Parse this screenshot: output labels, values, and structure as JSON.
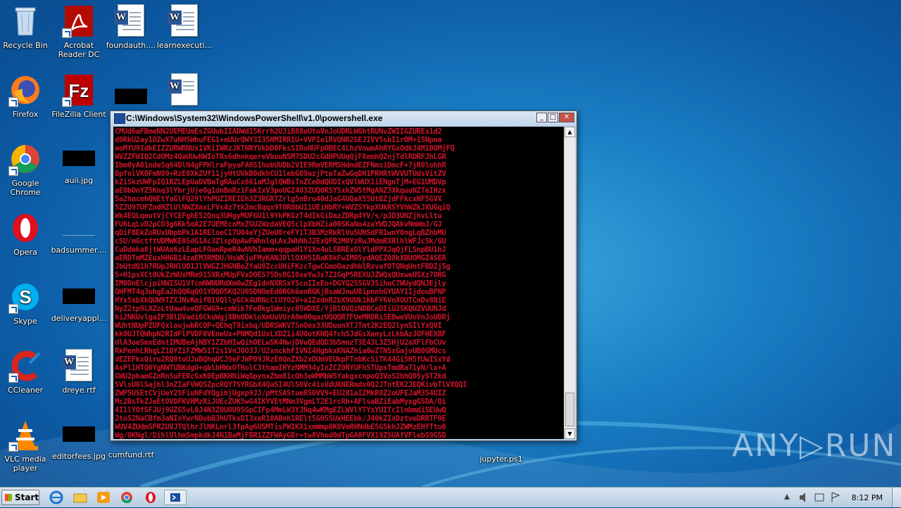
{
  "desktop": {
    "icons": [
      {
        "label": "Recycle Bin"
      },
      {
        "label": "Acrobat Reader DC"
      },
      {
        "label": "foundauth...."
      },
      {
        "label": "learnexecuti..."
      },
      {
        "label": "Firefox"
      },
      {
        "label": "FileZilla Client"
      },
      {
        "label": "Google Chrome"
      },
      {
        "label": "auii.jpg"
      },
      {
        "label": "Opera"
      },
      {
        "label": "badsummer...."
      },
      {
        "label": "Skype"
      },
      {
        "label": "deliveryappl..."
      },
      {
        "label": "CCleaner"
      },
      {
        "label": "dreye.rtf"
      },
      {
        "label": "VLC media player"
      },
      {
        "label": "editorfees.jpg"
      },
      {
        "label": "cumfund.rtf"
      },
      {
        "label": "jupyter.ps1"
      }
    ]
  },
  "window": {
    "title": "C:\\Windows\\System32\\WindowsPowerShell\\v1.0\\powershell.exe",
    "minimize": "_",
    "maximize": "□",
    "close": "✕",
    "scroll_up": "▲",
    "scroll_down": "▼",
    "text_color": "#d0132b",
    "console_lines": [
      "CMUd6aFBmeNN2UEMEUmEsZGUubIIADWd15Krrh2U3iB88eUtoVnJoUDRLWGhtRUNvZWIIGZUREx1d2",
      "d0RkU2ay1OZwX7uNHSWhuFEG1+eUUrQWY3I35HMIRR1U+VVPIe1RVQNR2SEJIVV5sbI1rOM+15Npna",
      "aoMfU9IdkEIZZURWRNUx1VKiIWRzJKTNRYVkbD0FksSIRoNUFpOBEC4LhzVowmAhRYGxOdkJ4M1BOMjFQ",
      "WVZZFWIQ2CdOMz4QaUUwNWIoTRs6dhnkqereVbuuNSM7SDU2cGdHPUUqQjFXemhQZnjTdlRDRFJhLGR",
      "Ibm0yA01ndeSq64DlN4gFPHlraFpyaFA0SIhobUUDb2VIE9RmVERMSHdndEZFNmsiDmcF+7jR0lohhR",
      "BpfnlVK0FmN09+RzE0XkZUf11jyHtUVkB0dkhCU1lebG09azjPteTaZwGqDH1PRHRtWVVUTUdsVitZV",
      "kZiSkzUWFpIQ1RZLEpUaDVBaTgRAuCx661aMJglQWBsTnZCeDdQUDIxQVlWUX1iENgnTjM+EG1UMDVp",
      "aE0bOnYZ5Knq3lYbrjUje0g1dnBnRz1FakIxV3poUGZ403ZUQ0RSYSxkZW5tMgANZ3XkquuNZTeIHzx",
      "5a2hacmhQNEtYaGlFQ29lYhPUZIREIEh3Z3RGRTZrlg5nBru40dJaG4UQaX55UtBZjdFFkcxNF5GVX",
      "5Z2U97UFZndHZlUlNWZXmxLFVs4z7tk2mcBqqx9T0R0bU11UEiHbRY+WVZSYkpXUkRSYVhWZkJXUGqiQ",
      "Wk4EQLqeutVjCYCEFghE52Qnq3UHgyMUFGU1l9YhPKGzT4dIkGiDazZDRp4YV/s/pJD3UNZjhvLltu",
      "FU6LqLvD2pCO3g6Kk5mA2E7UEMEcnMxZGU2WzdaVEQ5clpXbHZia00SKaNo4zaYWDJQAkvNmWmJ/GJ",
      "qDiF8EkZoRUxUbpbPk1A1RElneC17U04eYjZUeU8reFY1T3B3MzRkRlVuSUNSdFR1wnY0ngLqBZhbMU",
      "cSU/mGctftUDMWKE0SdG1Ac3ZlspOpAwFWhnlqLAxJWhNhJ2ExQFRJM0YzRwJMdmRXRlhlWFJcSk/GU",
      "CuDdeka8jtWUAx6zLEapLFOanRpeR4wNVhIamm+qqpaH1Y1Xn4uLSBRExOlYldPPXJqQjFLSnpBU1hJ",
      "aERDTmMZEuxHH6B14zaEM3RMDU/HsWKjuFMyKANJDllOXH51RaK8kFwIM05ydAQEZ08kXBUOMGZ4SER",
      "JbUtdQ1h7RUpJRHlUO1JlVWGZJHGNBoZfaU8ZccUHiFKzcTgwCGmoOazdhblRxvafOTQNqUntFBDZj5g",
      "5+H1psXCt0UkZzWUxMRm91SXRxMUpFVxDOES75Ds8G10xeYwJx7Z1GqP5REXUJZWQxQUxweUSXz70RG",
      "IM0OnElcjpiNWISU1VfcmNWNURdXm0wZEg1dnNXRSxYScoIIxEo+DGYQ25SGV3SihuC7WUydQNJEjly",
      "QHFMT4q3uhgEa2hQQRqQO1YDQD5KQ2U0SDNOeEd0RGh6enRGKjBsaWJnwU8ipnnhGYUAY1IjdouBFNP",
      "HYx5xbXkQUW9TZXJNvKmifB1VQllyGCk4URNcClUYO2V+a1ZxdnR2bX9UUk1KbFY6VnXOUTCnDv8NiE",
      "NyZ2tp9LAZoLtUaw4veQFGWG9+cmWik7FeBkg1Wmiyc05WDXE/YjBlOVQzNDBCeDIiU25KQUZVUUNJd",
      "hi2NKUvlgaIP3BlDVadi0CkuWgjXBhODkloXmUuVUrA0m00qazUQQQR7FUeMRDRiSEBweVUoVnJoUDRj",
      "WUhtNUpPZUFQxloujwbRCQP+QEhqT9ixbq/UDRSWKVTSnOex33UDuunXTJTmt2K2EQ2lynSIlYxQVI",
      "kk0UJTQWhpN2RIdFlPVDF0VEneUx+PNMQd1UxLXDZ1i4U0otKNQ4fchSJdGsXanyLzLkbAzJOFHEXBF",
      "dlA3oeSmxEdntIMUBeAjNBY1ZZbHIwQihOELwSK4NwjDVuQEdQD3bSmnzT3E43L3Z5HjU2aXFlFbCUv",
      "RkPenhLRhgLZ1QYZiFZMWS1T2s1VnJ0O3J/U2xnckhFIVNI4HgbkxKNAZhia0wZTNSxGajvUB0GMUcs",
      "dEZEFkxQiru2RQ9toUJuBQhqUCJ9eFJWP09JRzE0QnZXb2xDUmVEUkpFTnbKcSiTK44Gi5H5fUwISxYd",
      "AsPl1HTQ0YgNWTUBKdgO+qblbHWxOTHolC3thamIHYzNMM34yInZCZ0RYUFhSTUpsTmdRa71yN/lx+A",
      "GWU2pkamGZnRnSuFERcGxK0EpBKHNiWqGpynxZbm81cQh3eWMMbW5YakgxcnpoQ3VoS2hhQ05yST2kd",
      "SVlsU0lSajhl3nZIaFVWQSZpcRQY7SYRGbX4QaSI4UlS0Vc4isVdUANERmdv0Q2JTntEK2JEQKivbTlVXQQI",
      "ZWP5USEtCVjUeY25FiuNFdYQgihjUgxp9JJ/pMtSAStueR50VV9+EU281aIZMkR0Z2oUFEJaM354UIZ",
      "Mc2BsTkZJeEtOVDFKVHMzRiJUEcZUK5wG4IKYVEtMNm3VgmLT2E1rcRh+AFlsaBZiEabMyxgGSDA/Qi",
      "4I1lYOfSFJUj9UZG5vL0J4N3Z0U0U9SGpCIFp4MmLW3YJNq4wKMgEZLWVlYTYxYUITcIlnbmdiSEUwQ",
      "2toS2NaCBfm3aNInYwrNDobB3hUTkxDI3xeR10ABnh1RElt5G05SUxHEEbk/J40kZIxDztveDRRTF9E",
      "WUV4ZUdmSFRZUVJTQlhrJlNKLnrl3fpAg6USMTisPW1KX1xmWmp8K0VmRHNdbE5GSkhJZWMzEHfTto0",
      "Wg/0KNgl/DihlUlhmSmpkdkJ4N1BaMjFBR1ZZFWAyGBr+tw8Vhod0dTpGA0FVX19ZSUAfVFlebS9GSD"
    ]
  },
  "taskbar": {
    "start_label": "Start",
    "clock": "8:12 PM"
  },
  "watermark": "ANY▷RUN"
}
